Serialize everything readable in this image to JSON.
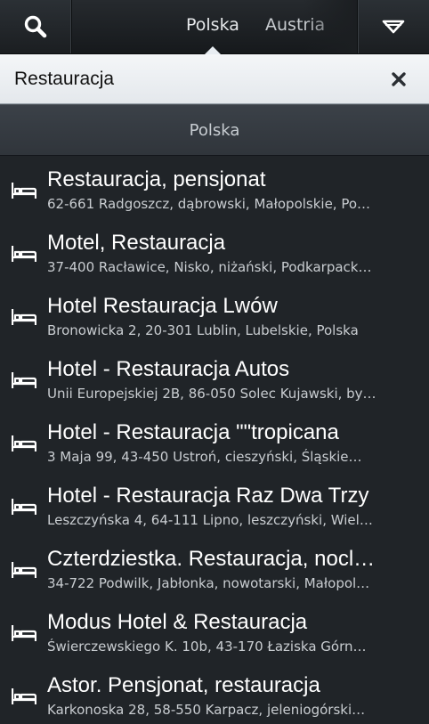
{
  "header": {
    "tabs": [
      {
        "label": "Polska"
      },
      {
        "label": "Austria"
      }
    ]
  },
  "search": {
    "value": "Restauracja"
  },
  "section": {
    "title": "Polska"
  },
  "results": [
    {
      "title": "Restauracja, pensjonat",
      "address": "62-661 Radgoszcz, dąbrowski, Małopolskie, Po…"
    },
    {
      "title": "Motel, Restauracja",
      "address": "37-400 Racławice, Nisko, niżański, Podkarpack…"
    },
    {
      "title": "Hotel Restauracja Lwów",
      "address": "Bronowicka 2, 20-301 Lublin, Lubelskie, Polska"
    },
    {
      "title": "Hotel - Restauracja Autos",
      "address": "Unii Europejskiej 2B, 86-050 Solec Kujawski, by…"
    },
    {
      "title": "Hotel - Restauracja \"\"tropicana",
      "address": "3 Maja 99, 43-450 Ustroń, cieszyński, Śląskie…"
    },
    {
      "title": "Hotel - Restauracja Raz Dwa Trzy",
      "address": "Leszczyńska 4, 64-111 Lipno, leszczyński, Wiel…"
    },
    {
      "title": "Czterdziestka. Restauracja, nocl…",
      "address": "34-722 Podwilk, Jabłonka, nowotarski, Małopol…"
    },
    {
      "title": "Modus Hotel & Restauracja",
      "address": "Świerczewskiego K. 10b, 43-170 Łaziska Górn…"
    },
    {
      "title": "Astor. Pensjonat, restauracja",
      "address": "Karkonoska 28, 58-550 Karpacz, jeleniogórski…"
    }
  ]
}
